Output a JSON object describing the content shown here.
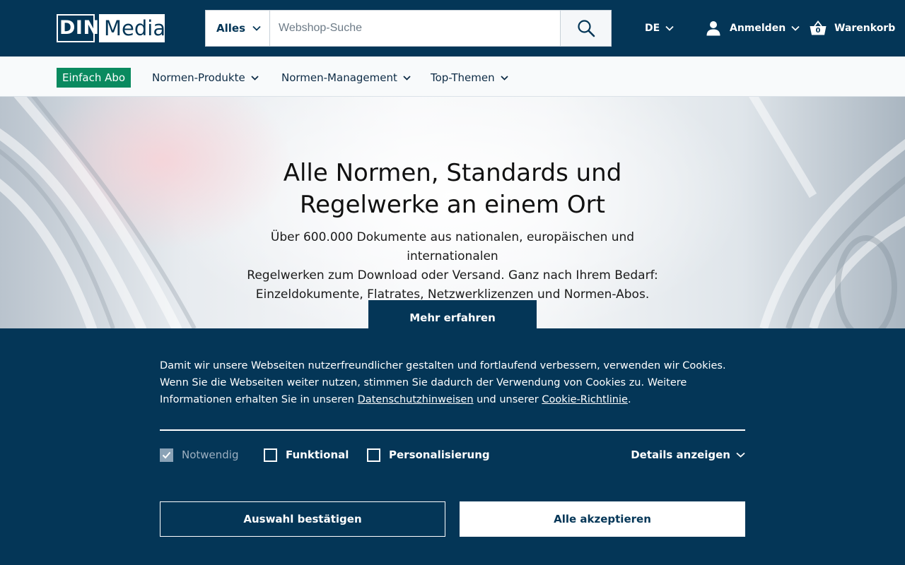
{
  "header": {
    "logo": {
      "din": "DIN",
      "media": "Media"
    },
    "search": {
      "category": "Alles",
      "placeholder": "Webshop-Suche",
      "value": ""
    },
    "language": "DE",
    "login_label": "Anmelden",
    "cart_label": "Warenkorb",
    "cart_count": "0"
  },
  "nav": {
    "abo_label": "Einfach Abo",
    "items": [
      {
        "label": "Normen-Produkte"
      },
      {
        "label": "Normen-Management"
      },
      {
        "label": "Top-Themen"
      }
    ]
  },
  "hero": {
    "title_line1": "Alle Normen, Standards und",
    "title_line2": "Regelwerke an einem Ort",
    "text_line1": "Über 600.000 Dokumente aus nationalen, europäischen und internationalen",
    "text_line2": "Regelwerken zum Download oder Versand. Ganz nach Ihrem Bedarf:",
    "text_line3": "Einzeldokumente, Flatrates, Netzwerklizenzen und Normen-Abos.",
    "cta_label": "Mehr erfahren"
  },
  "cookie": {
    "text_before": "Damit wir unsere Webseiten nutzerfreundlicher gestalten und fortlaufend verbessern, verwenden wir Cookies. Wenn Sie die Webseiten weiter nutzen, stimmen Sie dadurch der Verwendung von Cookies zu. Weitere Informationen erhalten Sie in unseren ",
    "privacy_link": "Datenschutzhinweisen",
    "text_middle": " und unserer ",
    "cookie_link": "Cookie-Richtlinie",
    "text_after": ".",
    "options": {
      "necessary": {
        "label": "Notwendig",
        "checked": true,
        "disabled": true
      },
      "functional": {
        "label": "Funktional",
        "checked": false
      },
      "personalization": {
        "label": "Personalisierung",
        "checked": false
      }
    },
    "details_label": "Details anzeigen",
    "confirm_label": "Auswahl bestätigen",
    "accept_all_label": "Alle akzeptieren"
  },
  "colors": {
    "primary": "#043657",
    "accent_green": "#0a8a5f",
    "nav_bg": "#f8fafb"
  }
}
